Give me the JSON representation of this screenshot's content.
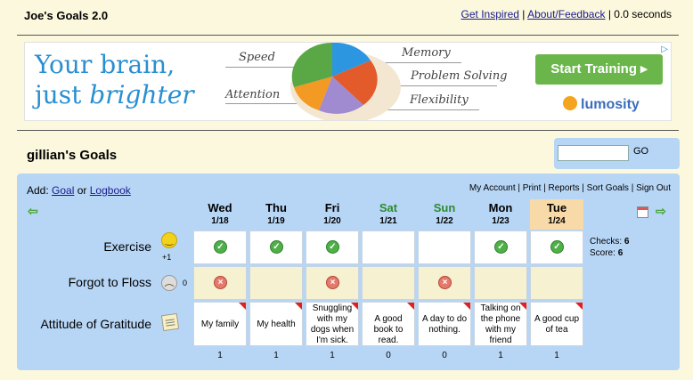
{
  "app": {
    "title": "Joe's Goals 2.0",
    "links": [
      "Get Inspired",
      "About/Feedback"
    ],
    "separator": "|",
    "load_time": "0.0 seconds"
  },
  "ad": {
    "headline_line1": "Your brain,",
    "headline_line2_plain": "just ",
    "headline_line2_em": "brighter",
    "labels": [
      "Speed",
      "Attention",
      "Memory",
      "Problem Solving",
      "Flexibility"
    ],
    "button": "Start Training",
    "brand": "lumosity",
    "colors": {
      "headline": "#2a8fd0",
      "button": "#6ab64b"
    }
  },
  "goals": {
    "title": "gillian's Goals",
    "search_value": "",
    "go_label": "GO",
    "add_prefix": "Add:",
    "add_goal": "Goal",
    "add_or": "or",
    "add_logbook": "Logbook",
    "menu": [
      "My Account",
      "Print",
      "Reports",
      "Sort Goals",
      "Sign Out"
    ],
    "days": [
      {
        "name": "Wed",
        "date": "1/18"
      },
      {
        "name": "Thu",
        "date": "1/19"
      },
      {
        "name": "Fri",
        "date": "1/20"
      },
      {
        "name": "Sat",
        "date": "1/21",
        "weekend": true
      },
      {
        "name": "Sun",
        "date": "1/22",
        "weekend": true
      },
      {
        "name": "Mon",
        "date": "1/23"
      },
      {
        "name": "Tue",
        "date": "1/24",
        "today": true
      }
    ],
    "rows": [
      {
        "name": "Exercise",
        "icon": "smiley-icon",
        "points": "+1",
        "cells": [
          "check",
          "check",
          "check",
          "",
          "",
          "check",
          "check"
        ]
      },
      {
        "name": "Forgot to Floss",
        "icon": "sad-face-icon",
        "points": "0",
        "cells": [
          "cross",
          "",
          "cross",
          "",
          "cross",
          "",
          ""
        ]
      },
      {
        "name": "Attitude of Gratitude",
        "icon": "note-icon",
        "points": "",
        "notes": [
          "My family",
          "My health",
          "Snuggling with my dogs when I'm sick.",
          "A good book to read.",
          "A day to do nothing.",
          "Talking on the phone with my friend",
          "A good cup of tea"
        ]
      }
    ],
    "stats": {
      "checks_label": "Checks:",
      "checks": "6",
      "score_label": "Score:",
      "score": "6"
    },
    "totals": [
      "1",
      "1",
      "1",
      "0",
      "0",
      "1",
      "1"
    ]
  }
}
